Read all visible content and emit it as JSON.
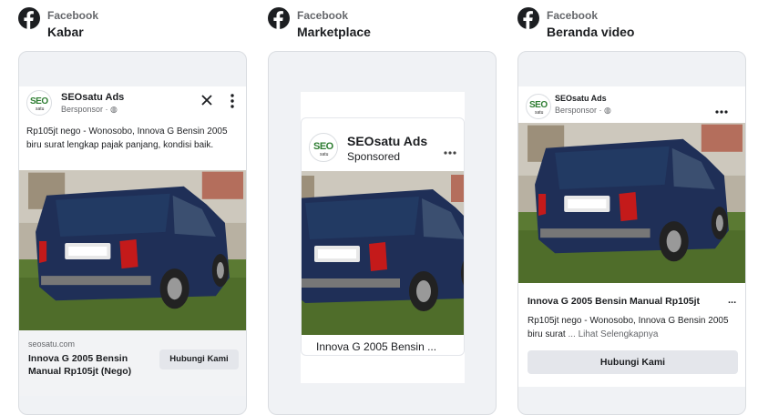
{
  "columns": [
    {
      "app": "Facebook",
      "placement": "Kabar"
    },
    {
      "app": "Facebook",
      "placement": "Marketplace"
    },
    {
      "app": "Facebook",
      "placement": "Beranda video"
    }
  ],
  "advertiser": {
    "name": "SEOsatu Ads",
    "logo_text": "SEO",
    "logo_sub": "satu"
  },
  "feed": {
    "sponsored_label": "Bersponsor · ",
    "body": "Rp105jt nego - Wonosobo, Innova G Bensin 2005 biru surat lengkap pajak panjang, kondisi baik.",
    "domain": "seosatu.com",
    "headline": "Innova G 2005 Bensin Manual Rp105jt (Nego)",
    "cta": "Hubungi Kami",
    "close_icon": "close-icon",
    "more_icon": "vertical-dots-icon"
  },
  "marketplace": {
    "sponsored_label": "Sponsored",
    "title": "Innova G 2005 Bensin ...",
    "more_icon": "horizontal-dots-icon"
  },
  "video": {
    "sponsored_label": "Bersponsor · ",
    "headline": "Innova G 2005 Bensin Manual Rp105jt",
    "ellipsis": "...",
    "body": "Rp105jt nego - Wonosobo, Innova G Bensin 2005 biru surat",
    "see_more": "... Lihat Selengkapnya",
    "cta": "Hubungi Kami",
    "more_icon": "horizontal-dots-icon"
  },
  "colors": {
    "car_body": "#1f2f57",
    "grass": "#5b7a33",
    "sky": "#c9c4b8",
    "button_bg": "#e4e6eb"
  }
}
